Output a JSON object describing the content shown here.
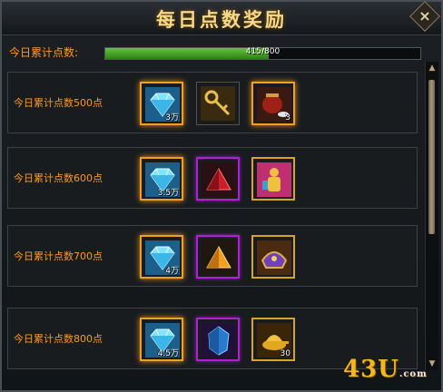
{
  "window": {
    "title": "每日点数奖励",
    "close_label": "×"
  },
  "points": {
    "label": "今日累计点数:",
    "current": 415,
    "max": 800,
    "text": "415/800"
  },
  "rows": [
    {
      "label": "今日累计点数500点",
      "rewards": [
        {
          "icon": "diamond-icon",
          "count": "3万",
          "frame": "orange"
        },
        {
          "icon": "golden-key-icon",
          "count": "",
          "frame": "plain"
        },
        {
          "icon": "treasure-pot-icon",
          "count": "3",
          "frame": "orange"
        }
      ]
    },
    {
      "label": "今日累计点数600点",
      "rewards": [
        {
          "icon": "diamond-icon",
          "count": "3.5万",
          "frame": "orange"
        },
        {
          "icon": "red-triangle-gem-icon",
          "count": "",
          "frame": "purple"
        },
        {
          "icon": "golden-statue-icon",
          "count": "",
          "frame": "gold"
        }
      ]
    },
    {
      "label": "今日累计点数700点",
      "rewards": [
        {
          "icon": "diamond-icon",
          "count": "4万",
          "frame": "orange"
        },
        {
          "icon": "orange-triangle-gem-icon",
          "count": "",
          "frame": "purple"
        },
        {
          "icon": "purple-helmet-icon",
          "count": "",
          "frame": "gold"
        }
      ]
    },
    {
      "label": "今日累计点数800点",
      "rewards": [
        {
          "icon": "diamond-icon",
          "count": "4.5万",
          "frame": "orange"
        },
        {
          "icon": "blue-crystal-icon",
          "count": "",
          "frame": "purple"
        },
        {
          "icon": "gold-lamp-icon",
          "count": "30",
          "frame": "gold"
        }
      ]
    }
  ],
  "watermark": {
    "main": "43U",
    "suffix": ".com"
  }
}
